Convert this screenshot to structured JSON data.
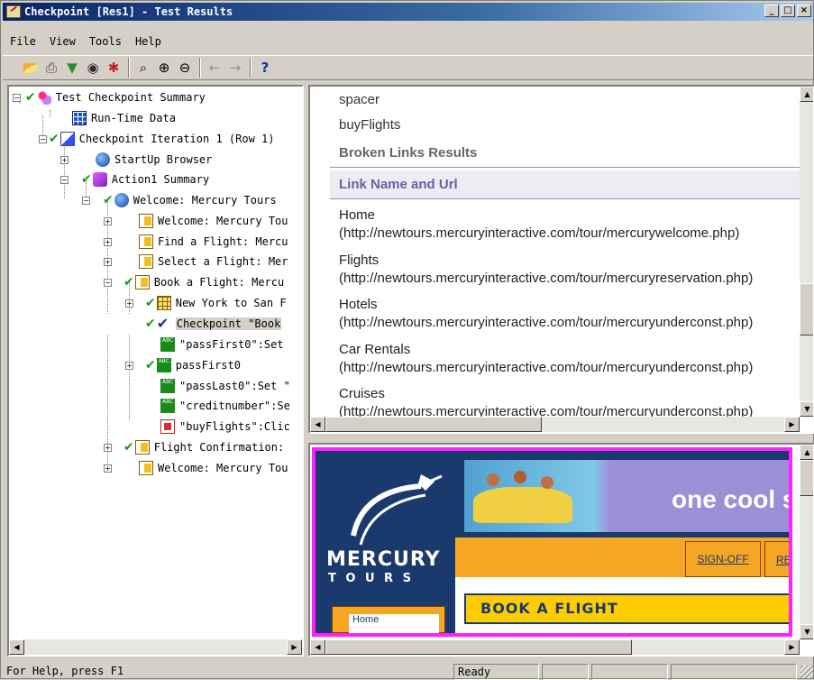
{
  "window": {
    "title": "Checkpoint [Res1] - Test Results"
  },
  "window_buttons": [
    "_",
    "□",
    "×"
  ],
  "menu": [
    "File",
    "View",
    "Tools",
    "Help"
  ],
  "toolbar_icons": [
    "open-folder-icon",
    "print-icon",
    "filter-icon",
    "find-icon",
    "checkpoint-icon",
    "search-icon",
    "zoom-in-icon",
    "zoom-out-icon",
    "back-arrow-icon",
    "forward-arrow-icon",
    "help-icon"
  ],
  "tree": [
    {
      "label": "Test Checkpoint Summary",
      "icon": "summary-icon",
      "checked": true
    },
    {
      "label": "Run-Time Data",
      "icon": "grid-icon",
      "checked": false
    },
    {
      "label": "Checkpoint Iteration 1  (Row 1)",
      "icon": "iteration-icon",
      "checked": true
    },
    {
      "label": "StartUp Browser",
      "icon": "browser-icon",
      "checked": false
    },
    {
      "label": "Action1 Summary",
      "icon": "action-icon",
      "checked": true
    },
    {
      "label": "Welcome: Mercury Tours",
      "icon": "browser-icon",
      "checked": true
    },
    {
      "label": "Welcome: Mercury Tou",
      "icon": "page-icon",
      "checked": false
    },
    {
      "label": "Find a Flight: Mercu",
      "icon": "page-icon",
      "checked": false
    },
    {
      "label": "Select a Flight: Mer",
      "icon": "page-icon",
      "checked": false
    },
    {
      "label": "Book a Flight: Mercu",
      "icon": "page-icon",
      "checked": true
    },
    {
      "label": "New York to San F",
      "icon": "table-icon",
      "checked": true
    },
    {
      "label": "Checkpoint \"Book",
      "icon": "checkpoint-icon",
      "checked": true
    },
    {
      "label": "\"passFirst0\":Set",
      "icon": "abc-icon",
      "checked": false
    },
    {
      "label": "passFirst0",
      "icon": "abc-icon",
      "checked": true
    },
    {
      "label": "\"passLast0\":Set \"",
      "icon": "abc-icon",
      "checked": false
    },
    {
      "label": "\"creditnumber\":Se",
      "icon": "abc-icon",
      "checked": false
    },
    {
      "label": "\"buyFlights\":Clic",
      "icon": "image-icon",
      "checked": false
    },
    {
      "label": "Flight Confirmation:",
      "icon": "page-icon",
      "checked": true
    },
    {
      "label": "Welcome: Mercury Tou",
      "icon": "page-icon",
      "checked": false
    }
  ],
  "results": {
    "top_items": [
      "spacer",
      "buyFlights"
    ],
    "section_title": "Broken Links Results",
    "column_header": "Link Name and Url",
    "links": [
      {
        "name": "Home",
        "url": "(http://newtours.mercuryinteractive.com/tour/mercurywelcome.php)"
      },
      {
        "name": "Flights",
        "url": "(http://newtours.mercuryinteractive.com/tour/mercuryreservation.php)"
      },
      {
        "name": "Hotels",
        "url": "(http://newtours.mercuryinteractive.com/tour/mercuryunderconst.php)"
      },
      {
        "name": "Car Rentals",
        "url": "(http://newtours.mercuryinteractive.com/tour/mercuryunderconst.php)"
      },
      {
        "name": "Cruises",
        "url": "(http://newtours.mercuryinteractive.com/tour/mercuryunderconst.php)"
      }
    ]
  },
  "preview": {
    "logo_line1": "MERCURY",
    "logo_line2": "T O U R S",
    "banner_text": "one cool s",
    "nav_links": [
      "SIGN-OFF",
      "RE"
    ],
    "book_title": "BOOK A FLIGHT",
    "side_link": "Home",
    "colors": {
      "navy": "#1a3a6e",
      "orange": "#f5a623",
      "yellow": "#ffcc00",
      "border": "#ff20ff"
    }
  },
  "status": {
    "help": "For Help, press F1",
    "state": "Ready"
  }
}
